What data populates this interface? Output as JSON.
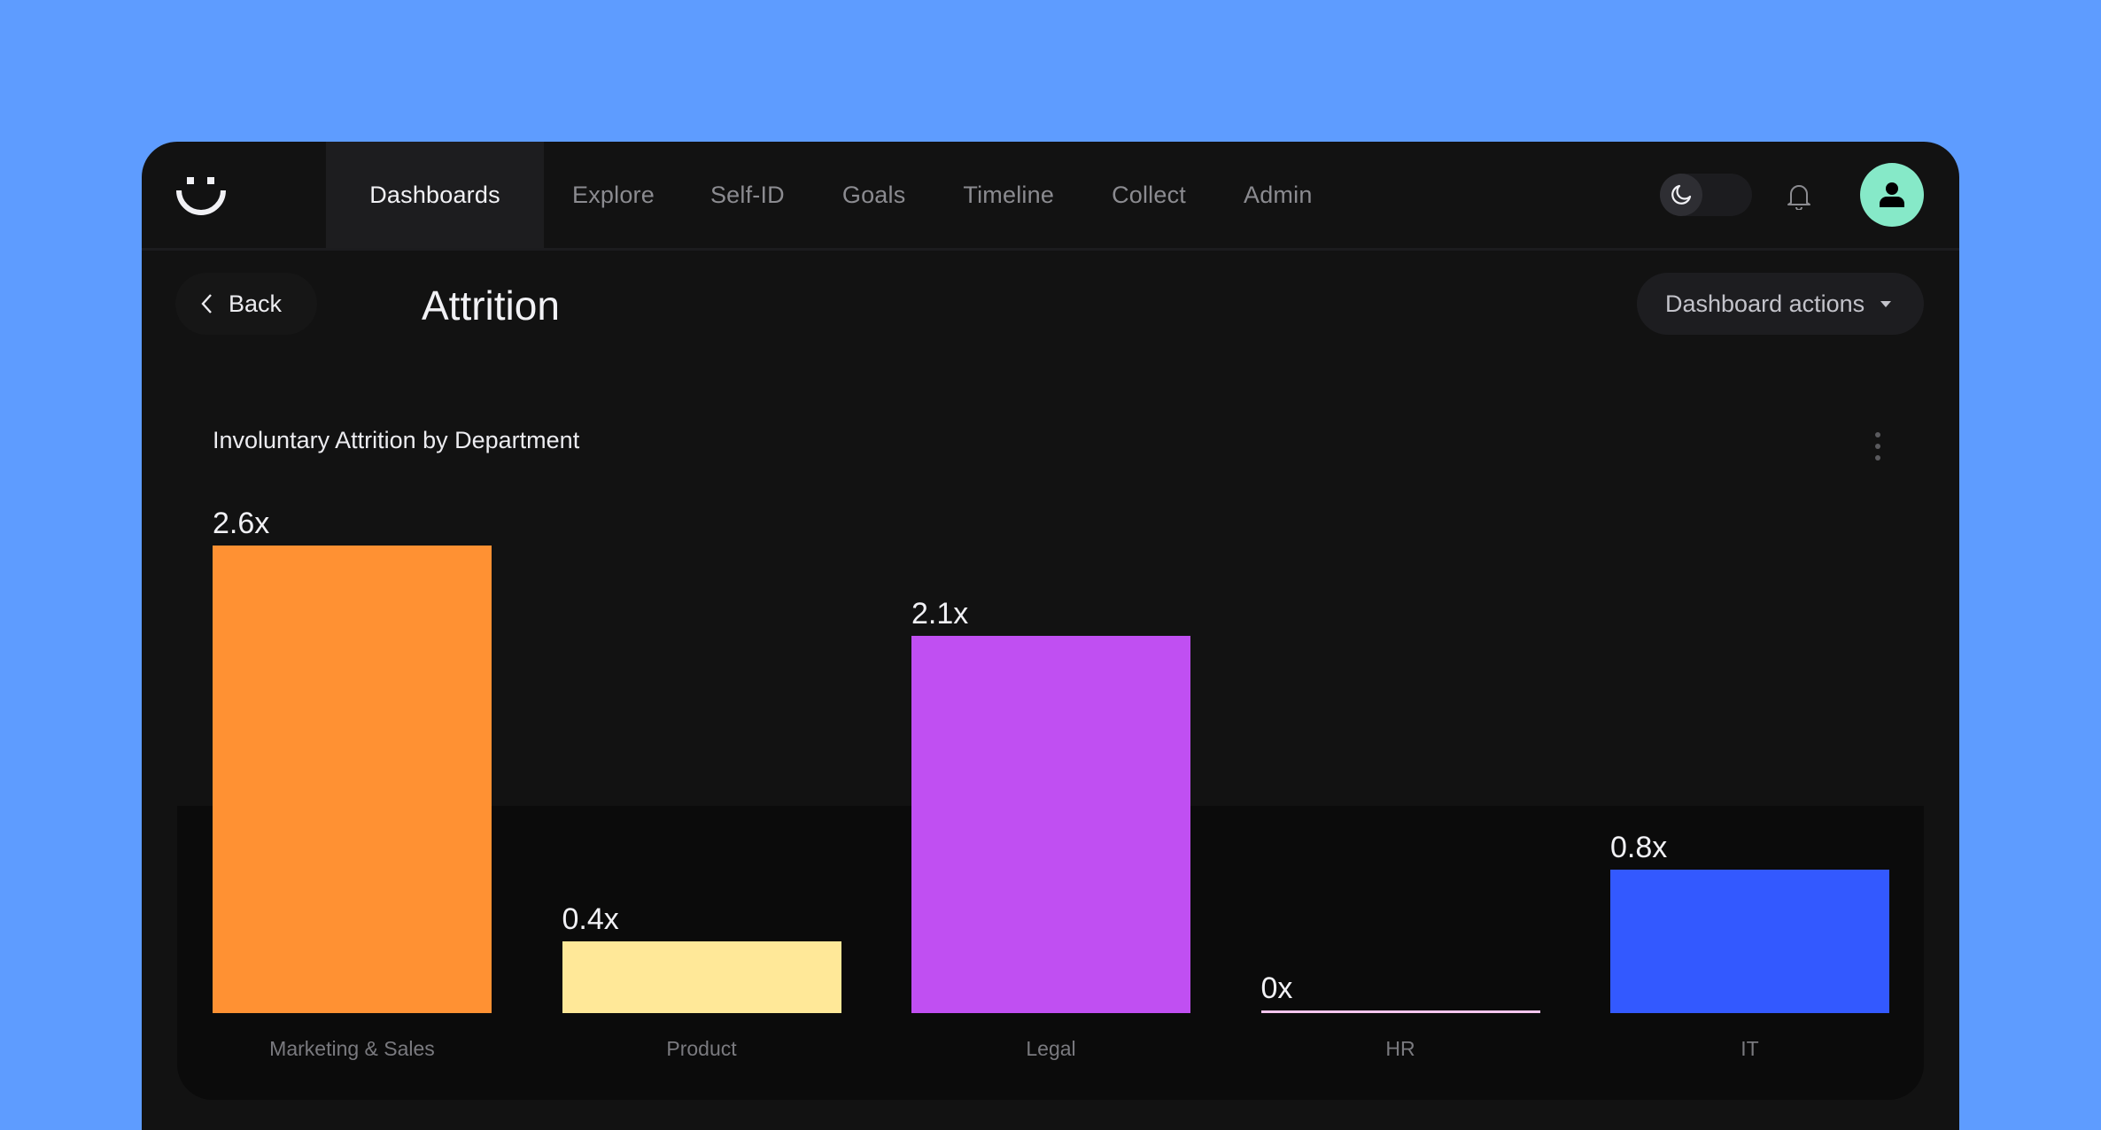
{
  "app": {
    "logo_icon": "smiley-logo-icon"
  },
  "nav": {
    "items": [
      {
        "label": "Dashboards",
        "active": true
      },
      {
        "label": "Explore",
        "active": false
      },
      {
        "label": "Self-ID",
        "active": false
      },
      {
        "label": "Goals",
        "active": false
      },
      {
        "label": "Timeline",
        "active": false
      },
      {
        "label": "Collect",
        "active": false
      },
      {
        "label": "Admin",
        "active": false
      }
    ],
    "theme_toggle_icon": "moon-icon",
    "notifications_icon": "bell-icon",
    "avatar_icon": "user-icon"
  },
  "header": {
    "back_label": "Back",
    "title": "Attrition",
    "actions_label": "Dashboard actions"
  },
  "colors": {
    "background": "#5e9cff",
    "window": "#121212",
    "avatar": "#86e9c8"
  },
  "chart_data": {
    "type": "bar",
    "title": "Involuntary Attrition by Department",
    "xlabel": "",
    "ylabel": "",
    "ylim": [
      0,
      2.6
    ],
    "grid": false,
    "categories": [
      "Marketing & Sales",
      "Product",
      "Legal",
      "HR",
      "IT"
    ],
    "values": [
      2.6,
      0.4,
      2.1,
      0,
      0.8
    ],
    "data_labels": [
      "2.6x",
      "0.4x",
      "2.1x",
      "0x",
      "0.8x"
    ],
    "colors": [
      "#ff9133",
      "#ffe898",
      "#c04ff2",
      "#f5c6ee",
      "#3359ff"
    ]
  }
}
